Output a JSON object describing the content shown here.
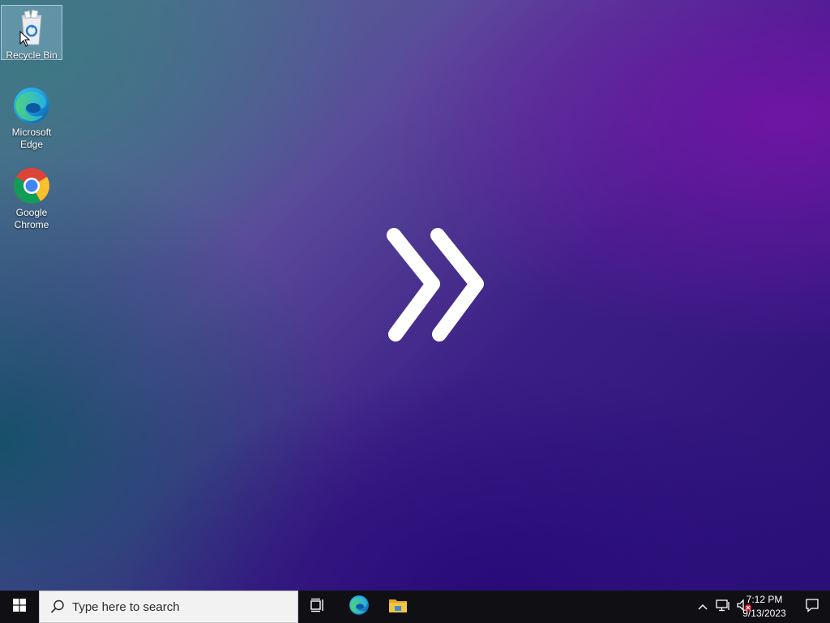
{
  "desktop": {
    "icons": [
      {
        "label": "Recycle Bin",
        "icon": "recycle-bin-icon",
        "selected": true
      },
      {
        "label": "Microsoft Edge",
        "icon": "edge-icon"
      },
      {
        "label": "Google Chrome",
        "icon": "chrome-icon"
      }
    ],
    "wallpaper_logo": "double-chevron-icon"
  },
  "taskbar": {
    "start_icon": "windows-logo-icon",
    "search_placeholder": "Type here to search",
    "pinned": [
      {
        "name": "Task View",
        "icon": "task-view-icon"
      },
      {
        "name": "Microsoft Edge",
        "icon": "edge-icon"
      },
      {
        "name": "File Explorer",
        "icon": "folder-icon"
      }
    ],
    "tray": {
      "icons": [
        "chevron-up-icon",
        "network-icon",
        "volume-muted-icon"
      ],
      "time": "7:12 PM",
      "date": "9/13/2023",
      "notification_icon": "notification-icon"
    }
  },
  "colors": {
    "taskbar_bg": "#101014",
    "search_bg": "#f2f2f2",
    "accent_folder": "#f4c542"
  }
}
